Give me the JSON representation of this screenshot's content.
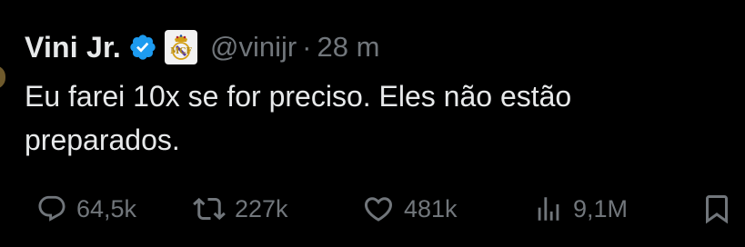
{
  "tweet": {
    "author_name": "Vini Jr.",
    "handle": "@vinijr",
    "separator": "·",
    "time": "28 m",
    "text": "Eu farei 10x se for preciso. Eles não estão preparados."
  },
  "badges": {
    "verified_icon": "verified-checkmark-icon",
    "verified_color": "#1d9bf0",
    "affiliate_icon": "real-madrid-crest-icon"
  },
  "actions": {
    "replies": "64,5k",
    "reposts": "227k",
    "likes": "481k",
    "views": "9,1M"
  },
  "colors": {
    "background": "#000000",
    "primary_text": "#e7e9ea",
    "secondary_text": "#71767b"
  }
}
